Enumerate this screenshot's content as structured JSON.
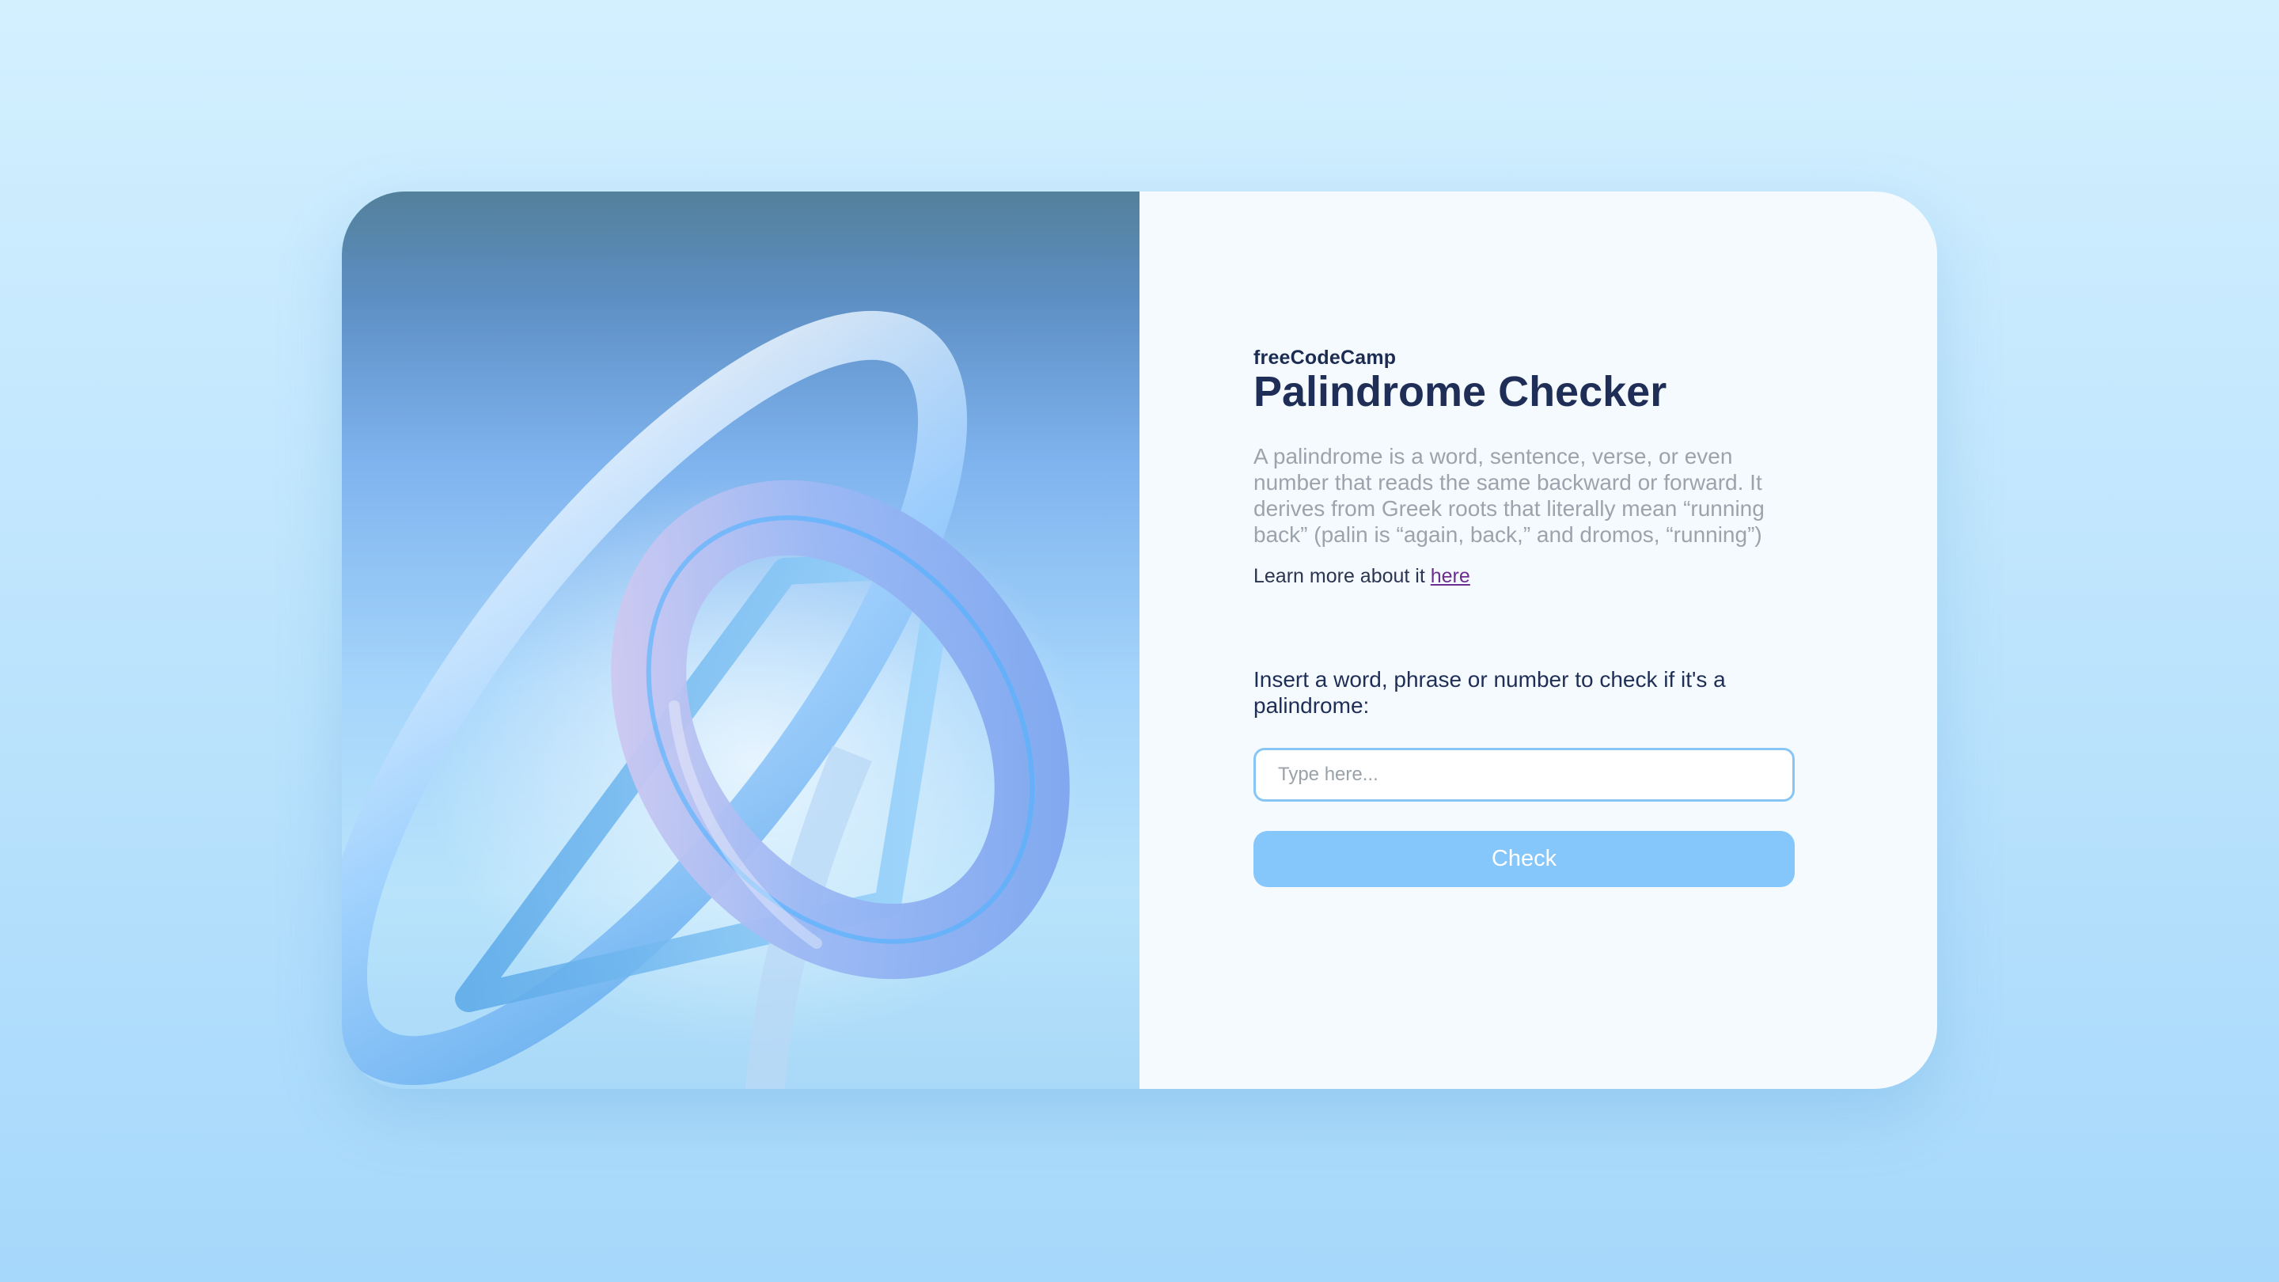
{
  "brand": "freeCodeCamp",
  "title": "Palindrome Checker",
  "description": "A palindrome is a word, sentence, verse, or even number that reads the same backward or forward. It derives from Greek roots that literally mean “running back” (palin is “again, back,” and dromos, “running”)",
  "learn_more": {
    "prefix": "Learn more about it ",
    "link_text": "here"
  },
  "prompt": "Insert a word, phrase or number to check if it's a palindrome:",
  "input": {
    "placeholder": "Type here...",
    "value": ""
  },
  "check_button_label": "Check",
  "colors": {
    "title": "#1f2e56",
    "description": "#9ba3ab",
    "button": "#85c6fb",
    "input_border": "#87c6f4",
    "link": "#6b2d8e"
  }
}
